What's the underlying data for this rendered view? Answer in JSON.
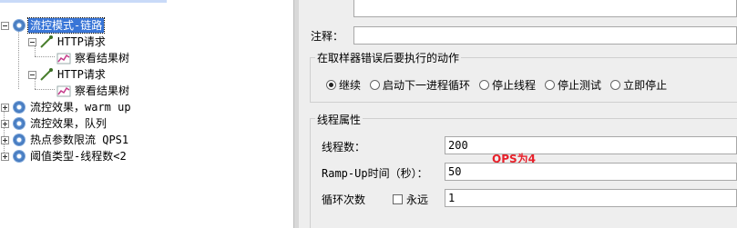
{
  "tree": {
    "nodes": [
      {
        "label": "流控模式-链路",
        "selected": true
      },
      {
        "label": "HTTP请求"
      },
      {
        "label": "察看结果树"
      },
      {
        "label": "HTTP请求"
      },
      {
        "label": "察看结果树"
      },
      {
        "label": "流控效果，warm up"
      },
      {
        "label": "流控效果，队列"
      },
      {
        "label": "热点参数限流 QPS1"
      },
      {
        "label": "阈值类型-线程数<2"
      }
    ]
  },
  "panel": {
    "comment_label": "注释：",
    "comment_value": "",
    "sampler_error_group": {
      "title": "在取样器错误后要执行的动作",
      "options": [
        {
          "label": "继续",
          "selected": true
        },
        {
          "label": "启动下一进程循环",
          "selected": false
        },
        {
          "label": "停止线程",
          "selected": false
        },
        {
          "label": "停止测试",
          "selected": false
        },
        {
          "label": "立即停止",
          "selected": false
        }
      ]
    },
    "thread_group": {
      "title": "线程属性",
      "threads_label": "线程数：",
      "threads_value": "200",
      "rampup_label": "Ramp-Up时间（秒）：",
      "rampup_value": "50",
      "loop_label": "循环次数",
      "forever_label": "永远",
      "loop_value": "1"
    },
    "annotation": "QPS为4"
  },
  "colors": {
    "selection": "#3875d7",
    "annotation": "#e8202a",
    "panel_bg": "#eeeeee"
  }
}
